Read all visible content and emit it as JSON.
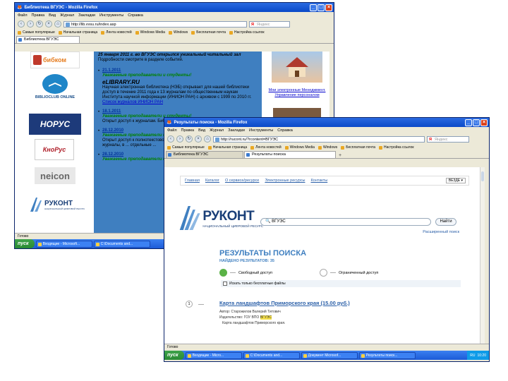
{
  "back_window": {
    "title": "Библиотека ВГУЭС - Mozilla Firefox",
    "menu": [
      "Файл",
      "Правка",
      "Вид",
      "Журнал",
      "Закладки",
      "Инструменты",
      "Справка"
    ],
    "url": "http://lib.vvsu.ru/index.asp",
    "search_placeholder": "Яндекс",
    "bookmarks": [
      "Самые популярные",
      "Начальная страница",
      "Лента новостей",
      "Windows Media",
      "Windows",
      "Бесплатная почта",
      "Настройка ссылок"
    ],
    "tab": "Библиотека ВГУЭС",
    "status": "Готово",
    "taskbar": {
      "start": "пуск",
      "items": [
        "Входящие - Microsoft...",
        "С:\\Documents and..."
      ],
      "clock": "RU"
    },
    "logos": [
      "бибком",
      "BIBLIOCLUB ONLINE",
      "НОРУС",
      "КноРус",
      "neicon",
      "РУКОНТ"
    ],
    "rukont_tagline": "НАЦИОНАЛЬНЫЙ ЦИФРОВОЙ РЕСУРС",
    "top_news": "25 января 2011 г. во ВГУЭС открылся уникальный читальный зал",
    "top_news_more": "Подробности смотрите в разделе событий.",
    "news": [
      {
        "date": "21.1.2011",
        "head": "Уважаемые преподаватели и студенты!",
        "body": "Научная электронная библиотека (НЭБ) открывает для нашей библиотеки доступ в течение 2011 года к 13 журналам по общественным наукам Института научной информации (ИНИОН РАН) с архивом с 1999 по 2010 гг.",
        "link": "Список журналов ИНИОН РАН"
      },
      {
        "date": "18.1.2011",
        "head": "Уважаемые преподаватели и студенты!",
        "body": "Открыт доступ к журналам. Библиотека ВГУЭС ...",
        "link": ""
      },
      {
        "date": "28.12.2010",
        "head": "Уважаемые преподаватели и студенты!",
        "body": "Открыт доступ к полнотекстовой базе ... ОРИОН для размещения ... русские журналы, в ... отдельные ...",
        "link": ""
      },
      {
        "date": "28.12.2010",
        "head": "Уважаемые преподаватели и студенты!",
        "body": "",
        "link": ""
      }
    ],
    "library_site_logo": "eLIBRARY.RU",
    "right_links": [
      "Мои электронные Менеджмент. Управление персоналом"
    ]
  },
  "front_window": {
    "title": "Результаты поиска - Mozilla Firefox",
    "menu": [
      "Файл",
      "Правка",
      "Вид",
      "Журнал",
      "Закладки",
      "Инструменты",
      "Справка"
    ],
    "url": "http://rucont.ru/?rcontent=ВГУЭС",
    "search_placeholder": "Яндекс",
    "bookmarks": [
      "Самые популярные",
      "Начальная страница",
      "Лента новостей",
      "Windows Media",
      "Windows",
      "Бесплатная почта",
      "Настройка ссылок"
    ],
    "tabs": [
      "Библиотека ВГУЭС",
      "Результаты поиска"
    ],
    "status": "Готово",
    "site_nav": [
      "Главная",
      "Каталог",
      "О сервисе/ресурсе",
      "Электронные ресурсы",
      "Контакты"
    ],
    "site_nav_dropdown": "ВЕЗДЕ",
    "logo_text": "РУКОНТ",
    "logo_tagline": "НАЦИОНАЛЬНЫЙ ЦИФРОВОЙ РЕСУРС",
    "search_value": "ВГУЭС",
    "find_button": "Найти",
    "advanced_search": "Расширенный поиск",
    "results_heading": "РЕЗУЛЬТАТЫ ПОИСКА",
    "results_found": "НАЙДЕНО РЕЗУЛЬТАТОВ: 35",
    "legend_free": "Свободный доступ",
    "legend_partial": "Ограниченный доступ",
    "checkbox_label": "Искать только бесплатные файлы",
    "result": {
      "index": "1",
      "title": "Карта ландшафтов Приморского края (15.00 руб.)",
      "author": "Автор: Старожилов Валерий Титович",
      "publisher_prefix": "Издательство: ГОУ ВПО ",
      "publisher_highlight": "ВГУЭС",
      "description": "Карта ландшафтов Приморского края."
    },
    "taskbar": {
      "start": "пуск",
      "items": [
        "Входящие - Micro...",
        "С:\\Documents and...",
        "Документ Microsof...",
        "Результаты поиск..."
      ],
      "lang": "RU",
      "clock": "10:20"
    }
  },
  "colors": {
    "free": "#5ab246",
    "partial": "#ffffff",
    "accent": "#2a5fa8",
    "rukont_blue": "#3f7fc0",
    "back_page_bg": "#3f7fc0"
  }
}
